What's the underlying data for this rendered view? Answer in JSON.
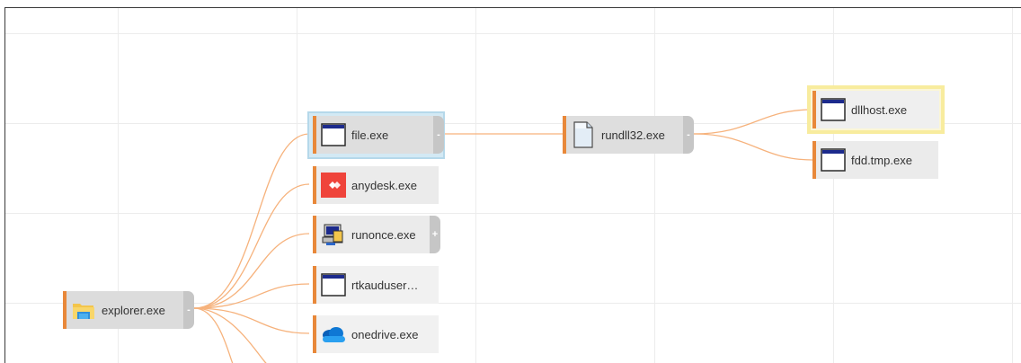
{
  "graph": {
    "root": {
      "label": "explorer.exe",
      "icon": "explorer-folder-icon",
      "toggle": "-"
    },
    "children": [
      {
        "label": "file.exe",
        "icon": "application-window-icon",
        "toggle": "-",
        "state": "selected"
      },
      {
        "label": "anydesk.exe",
        "icon": "anydesk-icon"
      },
      {
        "label": "runonce.exe",
        "icon": "setup-computer-icon",
        "toggle": "+"
      },
      {
        "label": "rtkauduser…",
        "icon": "application-window-icon"
      },
      {
        "label": "onedrive.exe",
        "icon": "onedrive-cloud-icon"
      }
    ],
    "grandchild": {
      "label": "rundll32.exe",
      "icon": "document-icon",
      "toggle": "-"
    },
    "leaves": [
      {
        "label": "dllhost.exe",
        "icon": "application-window-icon",
        "state": "highlighted"
      },
      {
        "label": "fdd.tmp.exe",
        "icon": "application-window-icon"
      }
    ]
  },
  "colors": {
    "edge": "#f6b27c",
    "accent": "#e8883a",
    "selected": "#b5d8ea",
    "highlight": "#f8ec9e",
    "anydesk": "#ef443b",
    "onedrive": "#0f78d4"
  }
}
